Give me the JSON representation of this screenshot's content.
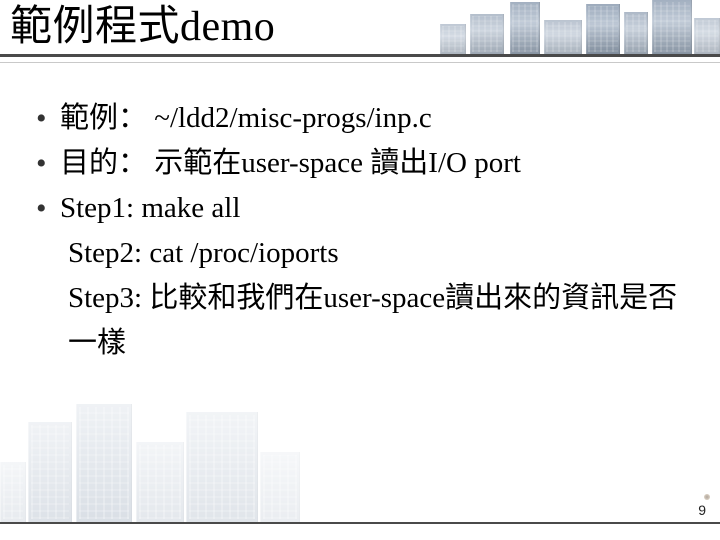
{
  "title": "範例程式demo",
  "bullets": {
    "b1": "範例： ~/ldd2/misc-progs/inp.c",
    "b2": "目的： 示範在user-space 讀出I/O port",
    "b3": "Step1: make all",
    "b3_cont1": "Step2: cat /proc/ioports",
    "b3_cont2": "Step3: 比較和我們在user-space讀出來的資訊是否一樣"
  },
  "page_number": "9"
}
